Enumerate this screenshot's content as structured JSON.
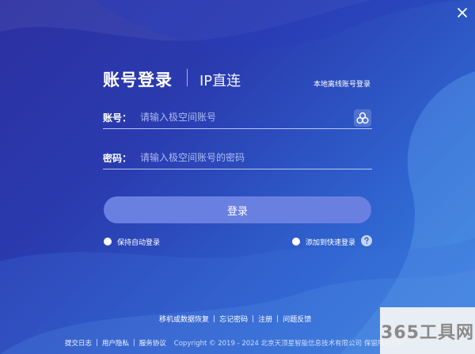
{
  "header": {
    "tab_account": "账号登录",
    "tab_ip": "IP直连",
    "local_account_link": "本地离线账号登录"
  },
  "account": {
    "label": "账号：",
    "placeholder": "请输入极空间账号"
  },
  "password": {
    "label": "密码：",
    "placeholder": "请输入极空间账号的密码"
  },
  "login_button": "登录",
  "options": {
    "auto_login": "保持自动登录",
    "quick_login": "添加到快速登录"
  },
  "footer_links": [
    "移机或数据恢复",
    "忘记密码",
    "注册",
    "问题反馈"
  ],
  "footer_bottom": {
    "links": [
      "提交日志",
      "用户隐私",
      "服务协议"
    ],
    "copyright": "Copyright © 2019 - 2024 北京天顶星智能信息技术有限公司 保留所有权利"
  },
  "watermark": "365工具网",
  "icons": {
    "close": "close-icon",
    "account_switch": "account-switch-icon",
    "help": "help-icon"
  },
  "colors": {
    "background_start": "#2c2fa0",
    "background_end": "#3a86e0",
    "login_button": "#6a80e0"
  }
}
